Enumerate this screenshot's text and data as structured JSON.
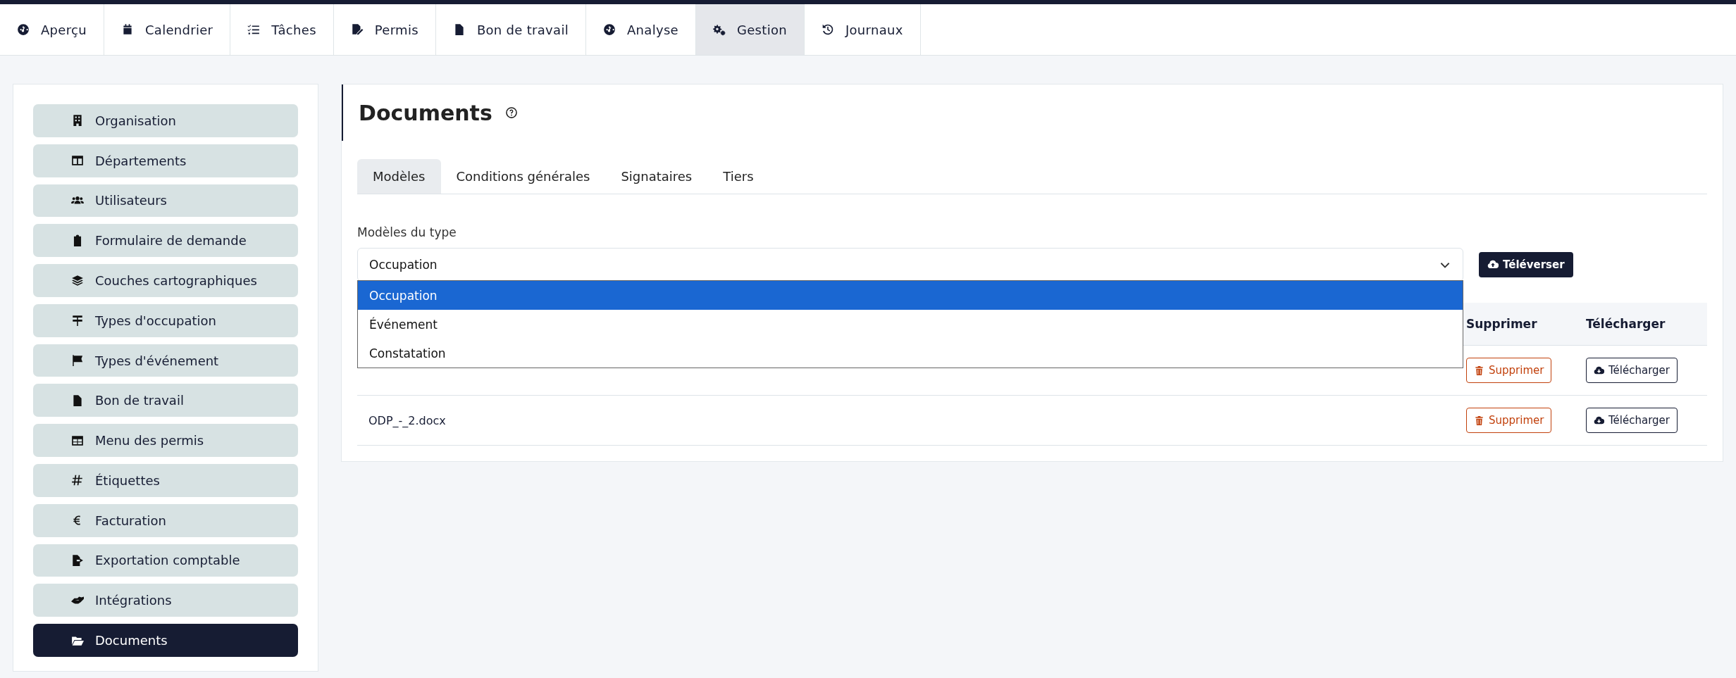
{
  "nav": [
    {
      "label": "Aperçu",
      "selected": false
    },
    {
      "label": "Calendrier",
      "selected": false
    },
    {
      "label": "Tâches",
      "selected": false
    },
    {
      "label": "Permis",
      "selected": false
    },
    {
      "label": "Bon de travail",
      "selected": false
    },
    {
      "label": "Analyse",
      "selected": false
    },
    {
      "label": "Gestion",
      "selected": true
    },
    {
      "label": "Journaux",
      "selected": false
    }
  ],
  "sidebar": {
    "items": [
      {
        "label": "Organisation",
        "selected": false
      },
      {
        "label": "Départements",
        "selected": false
      },
      {
        "label": "Utilisateurs",
        "selected": false
      },
      {
        "label": "Formulaire de demande",
        "selected": false
      },
      {
        "label": "Couches cartographiques",
        "selected": false
      },
      {
        "label": "Types d'occupation",
        "selected": false
      },
      {
        "label": "Types d'événement",
        "selected": false
      },
      {
        "label": "Bon de travail",
        "selected": false
      },
      {
        "label": "Menu des permis",
        "selected": false
      },
      {
        "label": "Étiquettes",
        "selected": false
      },
      {
        "label": "Facturation",
        "selected": false
      },
      {
        "label": "Exportation comptable",
        "selected": false
      },
      {
        "label": "Intégrations",
        "selected": false
      },
      {
        "label": "Documents",
        "selected": true
      }
    ]
  },
  "page": {
    "title": "Documents",
    "tabs": [
      {
        "label": "Modèles",
        "selected": true
      },
      {
        "label": "Conditions générales",
        "selected": false
      },
      {
        "label": "Signataires",
        "selected": false
      },
      {
        "label": "Tiers",
        "selected": false
      }
    ],
    "type_select": {
      "label": "Modèles du type",
      "value": "Occupation",
      "expanded": true,
      "options": [
        {
          "label": "Occupation",
          "selected": true
        },
        {
          "label": "Événement",
          "selected": false
        },
        {
          "label": "Constatation",
          "selected": false
        }
      ]
    },
    "upload_button": "Téléverser",
    "table": {
      "columns": [
        "Supprimer",
        "Télécharger"
      ],
      "rows": [
        {
          "delete": "Supprimer",
          "download": "Télécharger"
        },
        {
          "file": "ODP_-_2.docx",
          "delete": "Supprimer",
          "download": "Télécharger"
        }
      ]
    }
  }
}
